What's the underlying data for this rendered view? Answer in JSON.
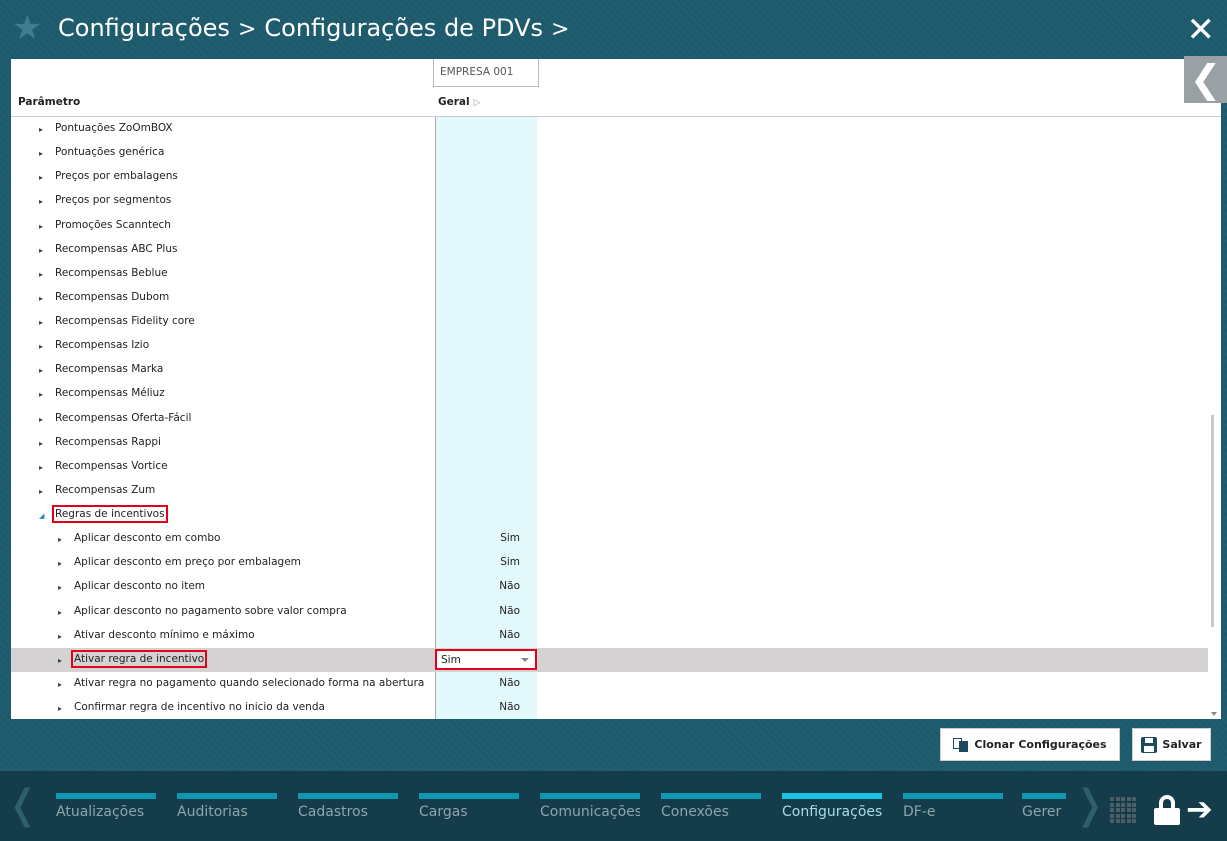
{
  "header": {
    "star_icon": "star-icon",
    "crumbs": [
      "Configurações",
      "Configurações de PDVs"
    ],
    "separator": ">"
  },
  "table": {
    "empresa_col": "EMPRESA 001",
    "param_header": "Parâmetro",
    "geral_header": "Geral"
  },
  "rows": [
    {
      "label": "Pontuações ZoOmBOX",
      "level": 1,
      "expanded": false,
      "value": ""
    },
    {
      "label": "Pontuações genérica",
      "level": 1,
      "expanded": false,
      "value": ""
    },
    {
      "label": "Preços por embalagens",
      "level": 1,
      "expanded": false,
      "value": ""
    },
    {
      "label": "Preços por segmentos",
      "level": 1,
      "expanded": false,
      "value": ""
    },
    {
      "label": "Promoções Scanntech",
      "level": 1,
      "expanded": false,
      "value": ""
    },
    {
      "label": "Recompensas ABC Plus",
      "level": 1,
      "expanded": false,
      "value": ""
    },
    {
      "label": "Recompensas Beblue",
      "level": 1,
      "expanded": false,
      "value": ""
    },
    {
      "label": "Recompensas Dubom",
      "level": 1,
      "expanded": false,
      "value": ""
    },
    {
      "label": "Recompensas Fidelity core",
      "level": 1,
      "expanded": false,
      "value": ""
    },
    {
      "label": "Recompensas Izio",
      "level": 1,
      "expanded": false,
      "value": ""
    },
    {
      "label": "Recompensas Marka",
      "level": 1,
      "expanded": false,
      "value": ""
    },
    {
      "label": "Recompensas Méliuz",
      "level": 1,
      "expanded": false,
      "value": ""
    },
    {
      "label": "Recompensas Oferta-Fácil",
      "level": 1,
      "expanded": false,
      "value": ""
    },
    {
      "label": "Recompensas Rappi",
      "level": 1,
      "expanded": false,
      "value": ""
    },
    {
      "label": "Recompensas Vortice",
      "level": 1,
      "expanded": false,
      "value": ""
    },
    {
      "label": "Recompensas Zum",
      "level": 1,
      "expanded": false,
      "value": ""
    },
    {
      "label": "Regras de incentivos",
      "level": 1,
      "expanded": true,
      "value": "",
      "highlight": true
    },
    {
      "label": "Aplicar desconto em combo",
      "level": 2,
      "expanded": false,
      "value": "Sim"
    },
    {
      "label": "Aplicar desconto em preço por embalagem",
      "level": 2,
      "expanded": false,
      "value": "Sim"
    },
    {
      "label": "Aplicar desconto no item",
      "level": 2,
      "expanded": false,
      "value": "Não"
    },
    {
      "label": "Aplicar desconto no pagamento sobre valor compra",
      "level": 2,
      "expanded": false,
      "value": "Não"
    },
    {
      "label": "Ativar desconto mínimo e máximo",
      "level": 2,
      "expanded": false,
      "value": "Não"
    },
    {
      "label": "Ativar regra de incentivo",
      "level": 2,
      "expanded": false,
      "value": "Sim",
      "highlight": true,
      "selected": true,
      "dropdown": true
    },
    {
      "label": "Ativar regra no pagamento quando selecionado forma na abertura",
      "level": 2,
      "expanded": false,
      "value": "Não"
    },
    {
      "label": "Confirmar regra de incentivo no inicio da venda",
      "level": 2,
      "expanded": false,
      "value": "Não"
    }
  ],
  "actions": {
    "clone_label": "Clonar Configurações",
    "save_label": "Salvar"
  },
  "bottom_nav": {
    "items": [
      {
        "label": "Atualizações",
        "active": false
      },
      {
        "label": "Auditorias",
        "active": false
      },
      {
        "label": "Cadastros",
        "active": false
      },
      {
        "label": "Cargas",
        "active": false
      },
      {
        "label": "Comunicações",
        "active": false
      },
      {
        "label": "Conexões",
        "active": false
      },
      {
        "label": "Configurações",
        "active": true
      },
      {
        "label": "DF-e",
        "active": false
      },
      {
        "label": "Gerer",
        "active": false
      }
    ]
  },
  "colors": {
    "background": "#1d5a6c",
    "bottom_nav": "#143c4a",
    "nav_bar": "#0f96b0",
    "nav_bar_active": "#17c3e3",
    "geral_column": "#e3f8fb",
    "selected_row": "#d4d2d3",
    "highlight": "#e3001b"
  }
}
